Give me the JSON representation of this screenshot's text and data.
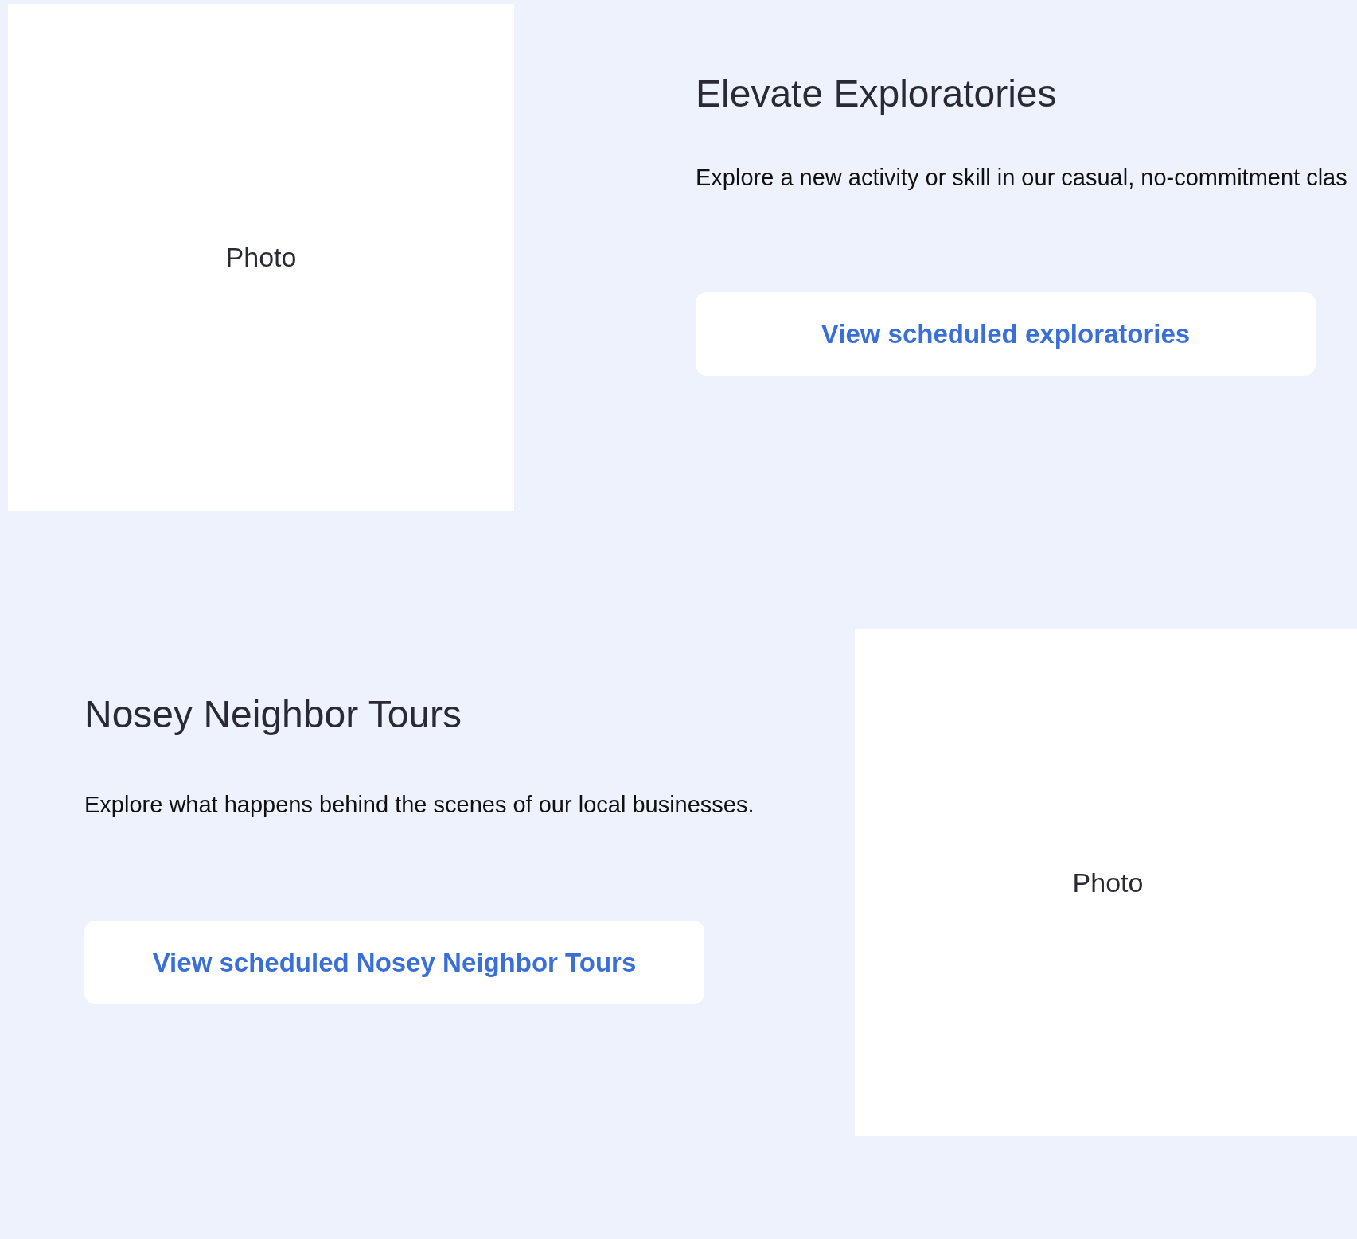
{
  "sections": [
    {
      "kind": "photo_left",
      "photo_label": "Photo",
      "title": "Elevate Exploratories",
      "description": "Explore a new activity or skill in our casual, no-commitment clas",
      "button": "View scheduled exploratories"
    },
    {
      "kind": "photo_right",
      "photo_label": "Photo",
      "title": "Nosey Neighbor Tours",
      "description": "Explore what happens behind the scenes of our local businesses.",
      "button": "View scheduled Nosey Neighbor Tours"
    }
  ]
}
